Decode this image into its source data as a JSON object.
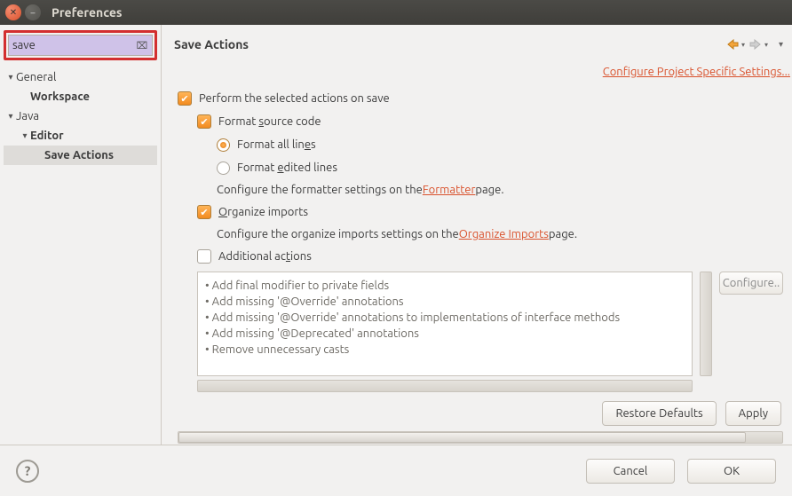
{
  "window": {
    "title": "Preferences"
  },
  "search": {
    "value": "save",
    "clear_tooltip": "Clear"
  },
  "tree": {
    "general": "General",
    "workspace": "Workspace",
    "java": "Java",
    "editor": "Editor",
    "save_actions": "Save Actions"
  },
  "page": {
    "title": "Save Actions",
    "project_link": "Configure Project Specific Settings...",
    "perform": "Perform the selected actions on save",
    "format_source": "Format source code",
    "format_all": "Format all lines",
    "format_edited": "Format edited lines",
    "formatter_hint_pre": "Configure the formatter settings on the ",
    "formatter_link": "Formatter",
    "formatter_hint_post": " page.",
    "organize_imports": "Organize imports",
    "organize_hint_pre": "Configure the organize imports settings on the ",
    "organize_link": "Organize Imports",
    "organize_hint_post": " page.",
    "additional_actions": "Additional actions",
    "configure_button": "Configure..",
    "actions_list": [
      "Add final modifier to private fields",
      "Add missing '@Override' annotations",
      "Add missing '@Override' annotations to implementations of interface methods",
      "Add missing '@Deprecated' annotations",
      "Remove unnecessary casts"
    ],
    "restore_defaults": "Restore Defaults",
    "apply": "Apply"
  },
  "footer": {
    "cancel": "Cancel",
    "ok": "OK"
  }
}
